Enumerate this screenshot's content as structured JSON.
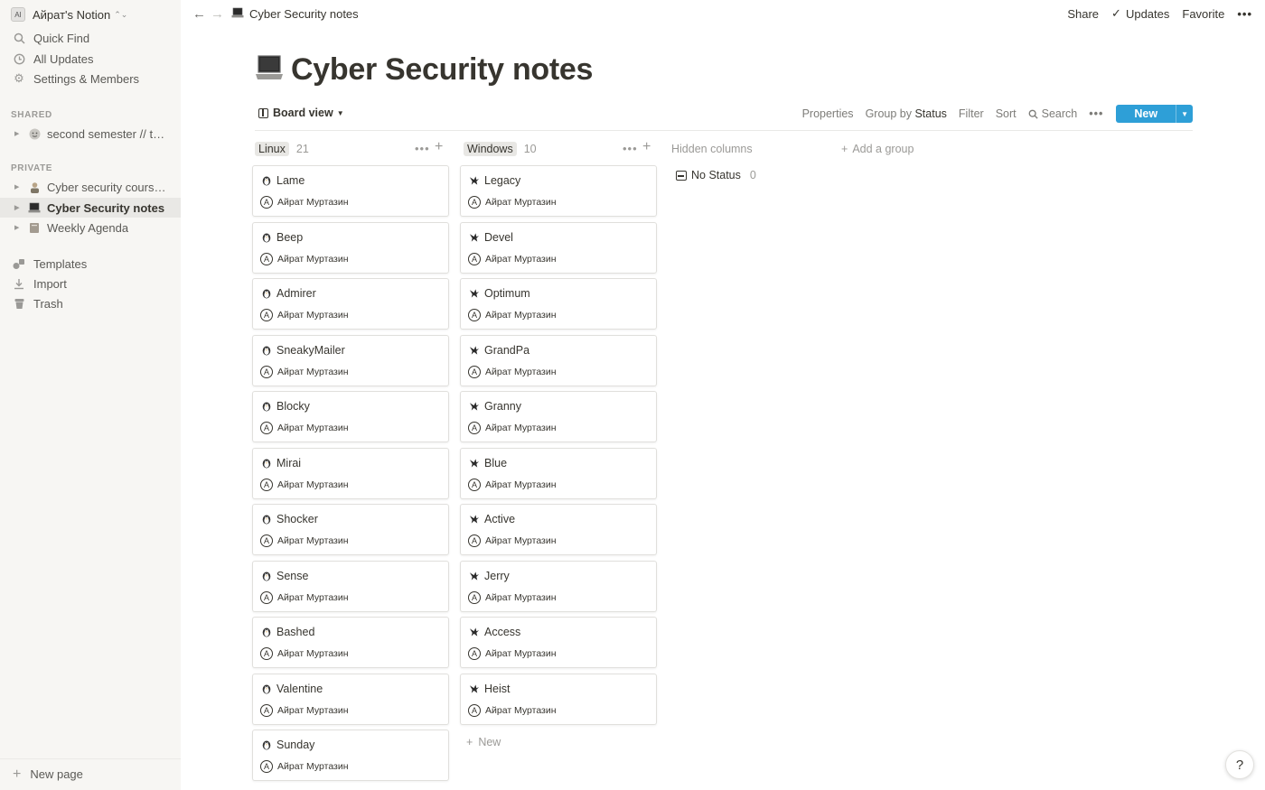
{
  "workspace": {
    "name": "Айрат's Notion",
    "avatar_text": "AI"
  },
  "sidebar": {
    "top_items": [
      {
        "label": "Quick Find",
        "icon": "search-icon"
      },
      {
        "label": "All Updates",
        "icon": "clock-icon"
      },
      {
        "label": "Settings & Members",
        "icon": "gear-icon"
      }
    ],
    "shared_label": "SHARED",
    "shared_pages": [
      {
        "label": "second semester // ter...",
        "icon": "face-emoji"
      }
    ],
    "private_label": "PRIVATE",
    "private_pages": [
      {
        "label": "Cyber security course...",
        "icon": "person-emoji"
      },
      {
        "label": "Cyber Security notes",
        "icon": "laptop-emoji"
      },
      {
        "label": "Weekly Agenda",
        "icon": "book-emoji"
      }
    ],
    "bottom_items": [
      {
        "label": "Templates",
        "icon": "shapes-icon"
      },
      {
        "label": "Import",
        "icon": "download-icon"
      },
      {
        "label": "Trash",
        "icon": "trash-icon"
      }
    ],
    "new_page_label": "New page"
  },
  "topbar": {
    "breadcrumb": "Cyber Security notes",
    "share": "Share",
    "updates": "Updates",
    "favorite": "Favorite",
    "more": "•••"
  },
  "page": {
    "title": "Cyber Security notes"
  },
  "view": {
    "name": "Board view",
    "properties": "Properties",
    "group_by_prefix": "Group by",
    "group_by_value": "Status",
    "filter": "Filter",
    "sort": "Sort",
    "search": "Search",
    "more": "•••",
    "new": "New"
  },
  "board": {
    "columns": [
      {
        "name": "Linux",
        "count": "21",
        "icon": "linux-penguin-icon",
        "cards": [
          "Lame",
          "Beep",
          "Admirer",
          "SneakyMailer",
          "Blocky",
          "Mirai",
          "Shocker",
          "Sense",
          "Bashed",
          "Valentine",
          "Sunday"
        ]
      },
      {
        "name": "Windows",
        "count": "10",
        "icon": "bird-icon",
        "cards": [
          "Legacy",
          "Devel",
          "Optimum",
          "GrandPa",
          "Granny",
          "Blue",
          "Active",
          "Jerry",
          "Access",
          "Heist"
        ],
        "new_label": "New"
      }
    ],
    "person": "Айрат Муртазин",
    "person_initial": "A",
    "hidden_columns_label": "Hidden columns",
    "add_group_label": "Add a group",
    "no_status": {
      "label": "No Status",
      "count": "0"
    }
  },
  "help": "?"
}
